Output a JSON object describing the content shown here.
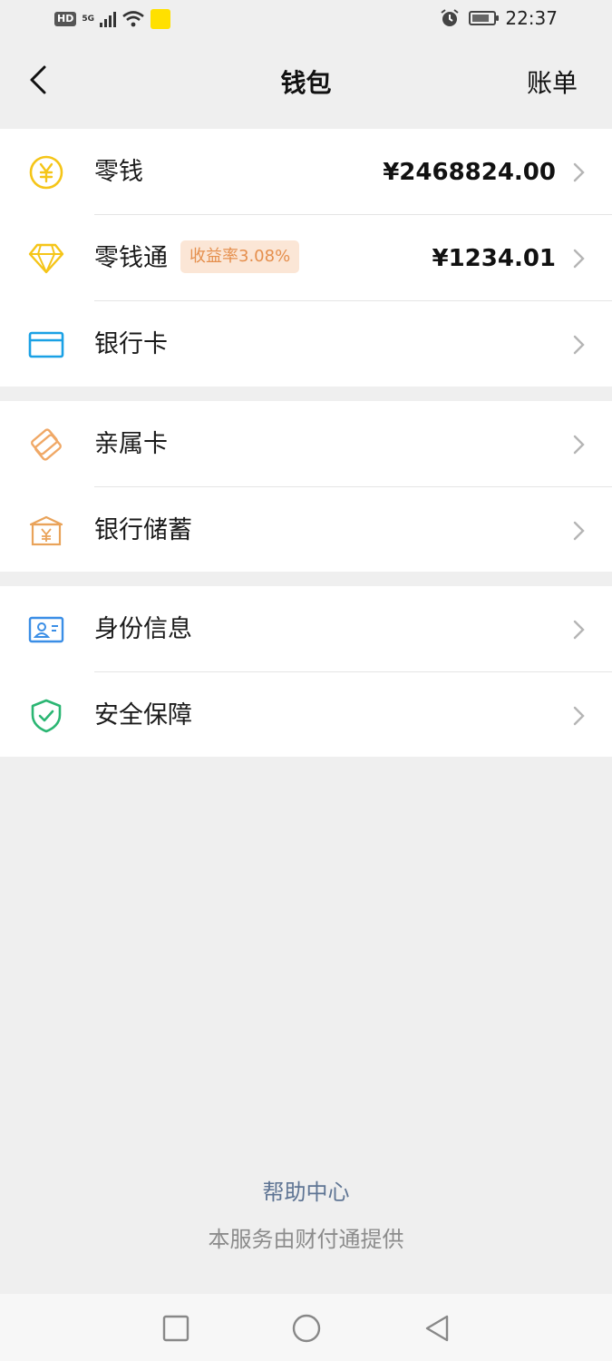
{
  "status_bar": {
    "hd": "HD",
    "network": "5G",
    "time": "22:37"
  },
  "header": {
    "title": "钱包",
    "bill_label": "账单"
  },
  "groups": [
    {
      "items": [
        {
          "label": "零钱",
          "amount": "¥2468824.00",
          "icon": "yen-coin-icon",
          "color": "#f5c518"
        },
        {
          "label": "零钱通",
          "tag": "收益率3.08%",
          "amount": "¥1234.01",
          "icon": "diamond-icon",
          "color": "#f5c518"
        },
        {
          "label": "银行卡",
          "icon": "bank-card-icon",
          "color": "#1aa1e5"
        }
      ]
    },
    {
      "items": [
        {
          "label": "亲属卡",
          "icon": "family-card-icon",
          "color": "#f0a866"
        },
        {
          "label": "银行储蓄",
          "icon": "bank-savings-icon",
          "color": "#e9a35a"
        }
      ]
    },
    {
      "items": [
        {
          "label": "身份信息",
          "icon": "id-card-icon",
          "color": "#3a8ee6"
        },
        {
          "label": "安全保障",
          "icon": "shield-check-icon",
          "color": "#2bb673"
        }
      ]
    }
  ],
  "footer": {
    "help_center": "帮助中心",
    "provider": "本服务由财付通提供"
  },
  "nav_bar": {
    "icons": [
      "recent-apps-icon",
      "home-icon",
      "back-icon"
    ]
  }
}
